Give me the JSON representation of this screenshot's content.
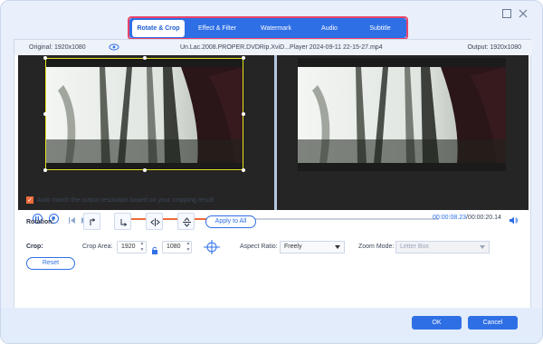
{
  "tabs": [
    {
      "label": "Rotate & Crop",
      "active": true
    },
    {
      "label": "Effect & Filter",
      "active": false
    },
    {
      "label": "Watermark",
      "active": false
    },
    {
      "label": "Audio",
      "active": false
    },
    {
      "label": "Subtitle",
      "active": false
    }
  ],
  "infobar": {
    "original": "Original: 1920x1080",
    "filename": "Un.Lac.2008.PROPER.DVDRip.XviD...Player 2024-09-11 22-15-27.mp4",
    "output": "Output: 1920x1080"
  },
  "playback": {
    "current_time": "00:00:08.23",
    "total_time": "/00:00:20.14",
    "progress_fraction": 0.41
  },
  "auto_match": {
    "label": "Auto match the output resolution based on your cropping result",
    "checked": true
  },
  "rotation": {
    "label": "Rotation:",
    "apply_all": "Apply to All"
  },
  "crop": {
    "label": "Crop:",
    "area_label": "Crop Area:",
    "width": "1920",
    "height": "1080",
    "aspect_label": "Aspect Ratio:",
    "aspect_value": "Freely",
    "zoom_label": "Zoom Mode:",
    "zoom_value": "Letter Box",
    "reset": "Reset"
  },
  "footer": {
    "ok": "OK",
    "cancel": "Cancel"
  },
  "colors": {
    "accent": "#2e6fe6",
    "highlight": "#e9456a",
    "progress": "#ef6b3a"
  }
}
